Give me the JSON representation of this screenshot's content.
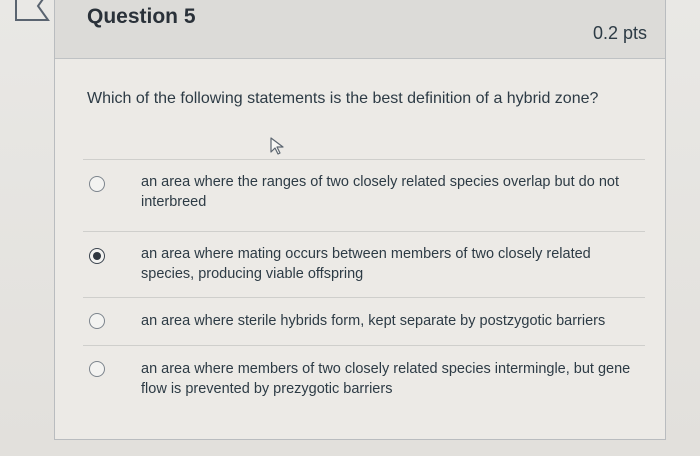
{
  "question": {
    "title": "Question 5",
    "points": "0.2 pts",
    "text": "Which of the following statements is the best definition of a hybrid zone?"
  },
  "answers": [
    {
      "label": "an area where the ranges of two closely related species overlap but do not interbreed",
      "selected": false
    },
    {
      "label": "an area where mating occurs between members of two closely related species, producing viable offspring",
      "selected": true
    },
    {
      "label": "an area where sterile hybrids form, kept separate by postzygotic barriers",
      "selected": false
    },
    {
      "label": "an area where members of two closely related species intermingle, but gene flow is prevented by prezygotic barriers",
      "selected": false
    }
  ],
  "icons": {
    "flag": "flag-icon",
    "cursor": "mouse-pointer-icon",
    "radio_selected": "radio-checked",
    "radio_unselected": "radio-unchecked"
  },
  "colors": {
    "text": "#2d3b45",
    "border": "#b9bcbf",
    "header_bg": "#dcdbd8"
  }
}
